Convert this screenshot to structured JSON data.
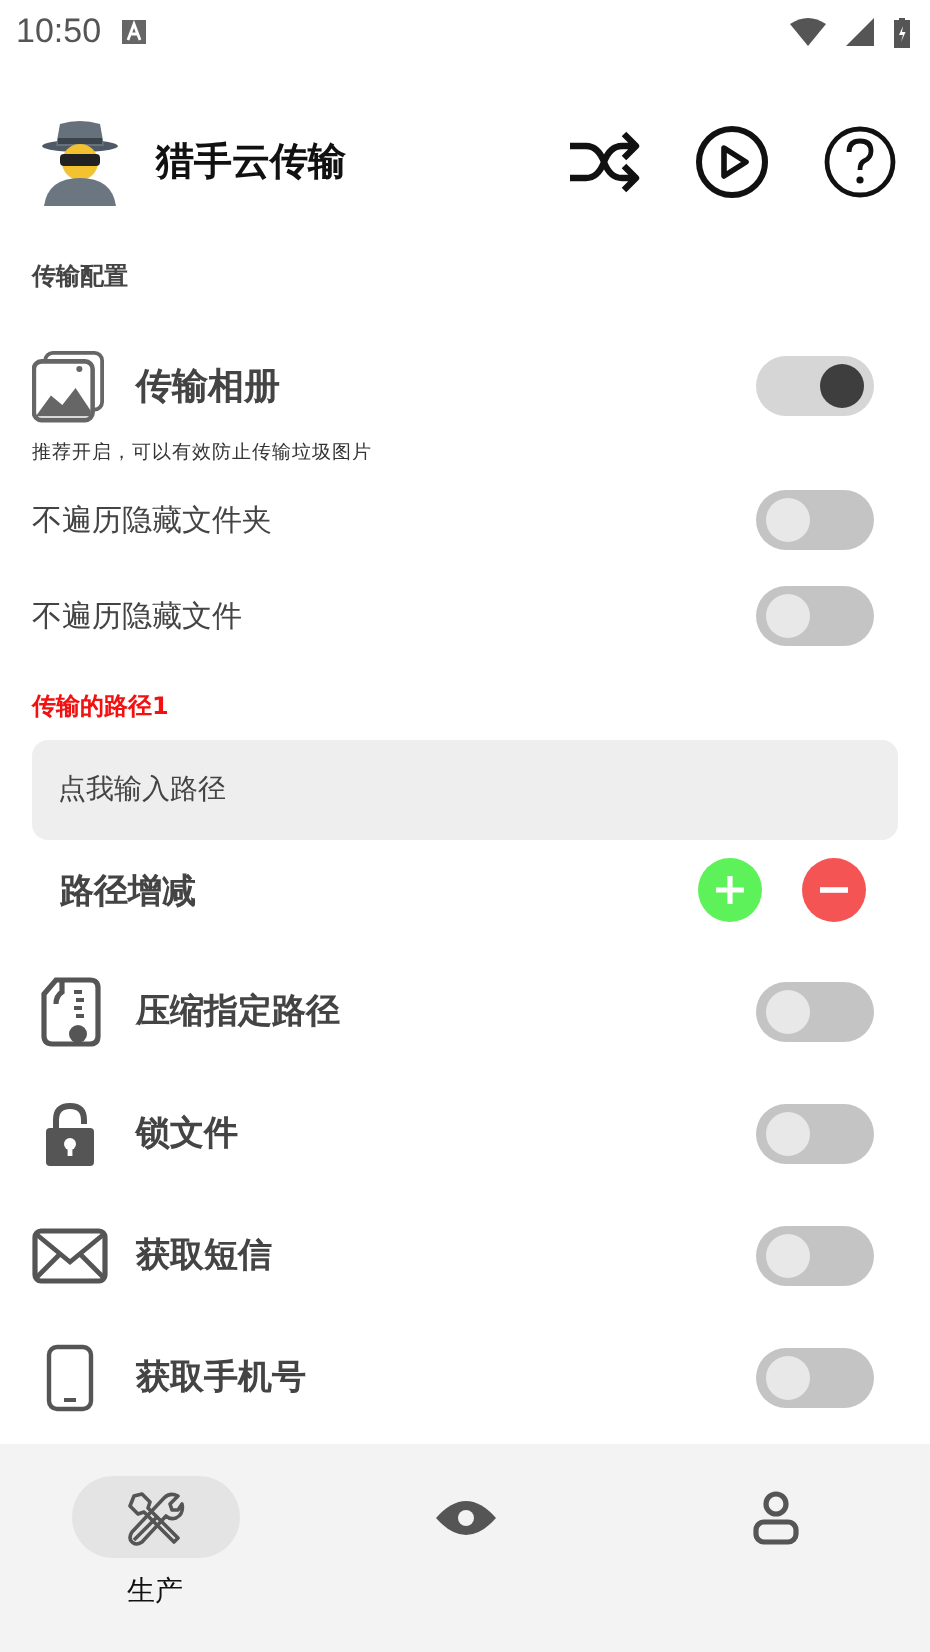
{
  "status_bar": {
    "time": "10:50"
  },
  "header": {
    "title": "猎手云传输"
  },
  "config": {
    "title": "传输配置",
    "options": [
      {
        "kind": "featured",
        "label": "传输相册",
        "hint": "推荐开启，可以有效防止传输垃圾图片",
        "on": true
      },
      {
        "kind": "plain",
        "label": "不遍历隐藏文件夹",
        "on": false
      },
      {
        "kind": "plain",
        "label": "不遍历隐藏文件",
        "on": false
      }
    ]
  },
  "path_section": {
    "label": "传输的路径1",
    "field": {
      "placeholder": "点我输入路径"
    },
    "adjust": {
      "label": "路径增减"
    }
  },
  "permissions": [
    {
      "label": "压缩指定路径",
      "on": false
    },
    {
      "label": "锁文件",
      "on": false
    },
    {
      "label": "获取短信",
      "on": false
    },
    {
      "label": "获取手机号",
      "on": false
    }
  ],
  "nav": [
    {
      "label": "生产",
      "selected": true
    },
    {
      "selected": false
    },
    {
      "selected": false
    }
  ]
}
